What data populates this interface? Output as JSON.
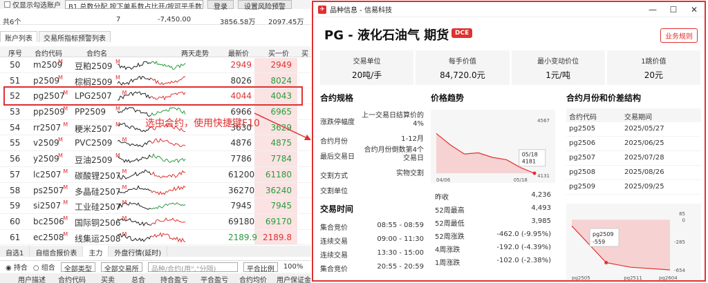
{
  "bg": {
    "only_show_checked_label": "仅显示勾选账户",
    "strategy_select": "B1.总数分配,按下单系数占比开/按可平手数占比平",
    "login_btn": "登录",
    "risk_btn": "设置风险预警",
    "summary": {
      "label": "共6个",
      "v1": "7",
      "v2": "-7,450.00",
      "v3": "3856.58万",
      "v4": "2097.45万"
    },
    "tabs": [
      "账户列表",
      "交易所指标预警列表"
    ],
    "headers": {
      "no": "序号",
      "code": "合约代码",
      "name": "合约名",
      "trend": "两天走势",
      "last": "最新价",
      "bid": "买一价",
      "ask": "买"
    },
    "rows": [
      {
        "no": "50",
        "code": "m2509",
        "name": "豆粕2509",
        "last": "2949",
        "bid": "2949",
        "lastColor": "#e0302f",
        "bidColor": "#e0302f"
      },
      {
        "no": "51",
        "code": "p2509",
        "name": "棕榈2509",
        "last": "8026",
        "bid": "8024",
        "lastColor": "#333333",
        "bidColor": "#2a9a3c"
      },
      {
        "no": "52",
        "code": "pg2507",
        "name": "LPG2507",
        "last": "4044",
        "bid": "4043",
        "lastColor": "#e0302f",
        "bidColor": "#2a9a3c"
      },
      {
        "no": "53",
        "code": "pp2509",
        "name": "PP2509",
        "last": "6966",
        "bid": "6965",
        "lastColor": "#333333",
        "bidColor": "#2a9a3c"
      },
      {
        "no": "54",
        "code": "rr2507",
        "name": "粳米2507",
        "last": "3630",
        "bid": "3629",
        "lastColor": "#333333",
        "bidColor": "#2a9a3c"
      },
      {
        "no": "55",
        "code": "v2509",
        "name": "PVC2509",
        "last": "4876",
        "bid": "4875",
        "lastColor": "#333333",
        "bidColor": "#2a9a3c"
      },
      {
        "no": "56",
        "code": "y2509",
        "name": "豆油2509",
        "last": "7786",
        "bid": "7784",
        "lastColor": "#333333",
        "bidColor": "#2a9a3c"
      },
      {
        "no": "57",
        "code": "lc2507",
        "name": "碳酸锂2507",
        "last": "61200",
        "bid": "61180",
        "lastColor": "#333333",
        "bidColor": "#2a9a3c"
      },
      {
        "no": "58",
        "code": "ps2507",
        "name": "多晶硅2507",
        "last": "36270",
        "bid": "36240",
        "lastColor": "#333333",
        "bidColor": "#2a9a3c"
      },
      {
        "no": "59",
        "code": "si2507",
        "name": "工业硅2507",
        "last": "7945",
        "bid": "7945",
        "lastColor": "#333333",
        "bidColor": "#2a9a3c"
      },
      {
        "no": "60",
        "code": "bc2506",
        "name": "国际铜2506",
        "last": "69180",
        "bid": "69170",
        "lastColor": "#333333",
        "bidColor": "#2a9a3c"
      },
      {
        "no": "61",
        "code": "ec2508",
        "name": "线集运2508",
        "last": "2189.9",
        "bid": "2189.8",
        "lastColor": "#2a9a3c",
        "bidColor": "#e0302f"
      }
    ],
    "superscript": "M",
    "tip": "选中合约，使用快捷键F10",
    "bottom_tabs": [
      "自选1",
      "自组合报价表",
      "主力",
      "外盘行情(延时)"
    ],
    "bottom_bar": {
      "hold": "持合",
      "combo": "组合",
      "type_sel": "全部类型",
      "exch_sel": "全部交易所",
      "search_ph": "品种/合约(用\",\"分隔)",
      "ratio": "平合比例",
      "pct": "100%"
    },
    "bottom_head": [
      "用户描述",
      "合约代码",
      "买卖",
      "总合",
      "持合盈亏",
      "平合盈亏",
      "合约均价",
      "用户保证金"
    ]
  },
  "dialog": {
    "window_title": "品种信息 - 信易科技",
    "product_title": "PG - 液化石油气 期货",
    "exchange_badge": "DCE",
    "rules_btn": "业务规则",
    "stats": [
      {
        "label": "交易单位",
        "value": "20吨/手"
      },
      {
        "label": "每手价值",
        "value": "84,720.0元"
      },
      {
        "label": "最小变动价位",
        "value": "1元/吨"
      },
      {
        "label": "1跳价值",
        "value": "20元"
      }
    ],
    "spec_title": "合约规格",
    "spec": [
      {
        "k": "涨跌停幅度",
        "v": "上一交易日结算价的4%"
      },
      {
        "k": "合约月份",
        "v": "1-12月"
      },
      {
        "k": "最后交易日",
        "v": "合约月份倒数第4个交易日"
      },
      {
        "k": "交割方式",
        "v": "实物交割"
      },
      {
        "k": "交割单位",
        "v": ""
      }
    ],
    "time_title": "交易时间",
    "times": [
      {
        "k": "集合竞价",
        "v": "08:55 - 08:59"
      },
      {
        "k": "连续交易",
        "v": "09:00 - 11:30"
      },
      {
        "k": "连续交易",
        "v": "13:30 - 15:00"
      },
      {
        "k": "集合竞价",
        "v": "20:55 - 20:59"
      }
    ],
    "trend_title": "价格趋势",
    "trend_stats": [
      {
        "k": "昨收",
        "v": "4,236"
      },
      {
        "k": "52周最高",
        "v": "4,493"
      },
      {
        "k": "52周最低",
        "v": "3,985"
      },
      {
        "k": "52周涨跌",
        "v": "-462.0 (-9.95%)"
      },
      {
        "k": "4周涨跌",
        "v": "-192.0 (-4.39%)"
      },
      {
        "k": "1周涨跌",
        "v": "-102.0 (-2.38%)"
      }
    ],
    "months_title": "合约月份和价差结构",
    "months_head": {
      "code": "合约代码",
      "period": "交易期间"
    },
    "months": [
      {
        "code": "pg2505",
        "date": "2025/05/27"
      },
      {
        "code": "pg2506",
        "date": "2025/06/25"
      },
      {
        "code": "pg2507",
        "date": "2025/07/28"
      },
      {
        "code": "pg2508",
        "date": "2025/08/26"
      },
      {
        "code": "pg2509",
        "date": "2025/09/25"
      }
    ],
    "colors": {
      "accent": "#e0302f",
      "up": "#e0302f",
      "down": "#2a9a3c"
    }
  },
  "chart_data": [
    {
      "type": "area",
      "x": [
        "04/06",
        "",
        "",
        "",
        "",
        "",
        "05/18",
        ""
      ],
      "values": [
        4480,
        4380,
        4300,
        4310,
        4270,
        4250,
        4181,
        4131
      ],
      "ylim": [
        4131,
        4567
      ],
      "ytick_labels": [
        "4567",
        "4131"
      ],
      "xtick_labels": [
        "04/06",
        "05/18"
      ],
      "tooltip": {
        "date": "05/18",
        "value": "4181"
      }
    },
    {
      "type": "area",
      "categories": [
        "pg2505",
        "pg2509",
        "pg2511",
        "pg2604"
      ],
      "values": [
        -80,
        -559,
        -620,
        -654
      ],
      "ylim": [
        -654,
        85
      ],
      "ytick_labels": [
        "85",
        "0",
        "-285",
        "-654"
      ],
      "xtick_labels": [
        "pg2505",
        "pg2511",
        "pg2604"
      ],
      "tooltip": {
        "code": "pg2509",
        "value": "-559"
      }
    }
  ]
}
